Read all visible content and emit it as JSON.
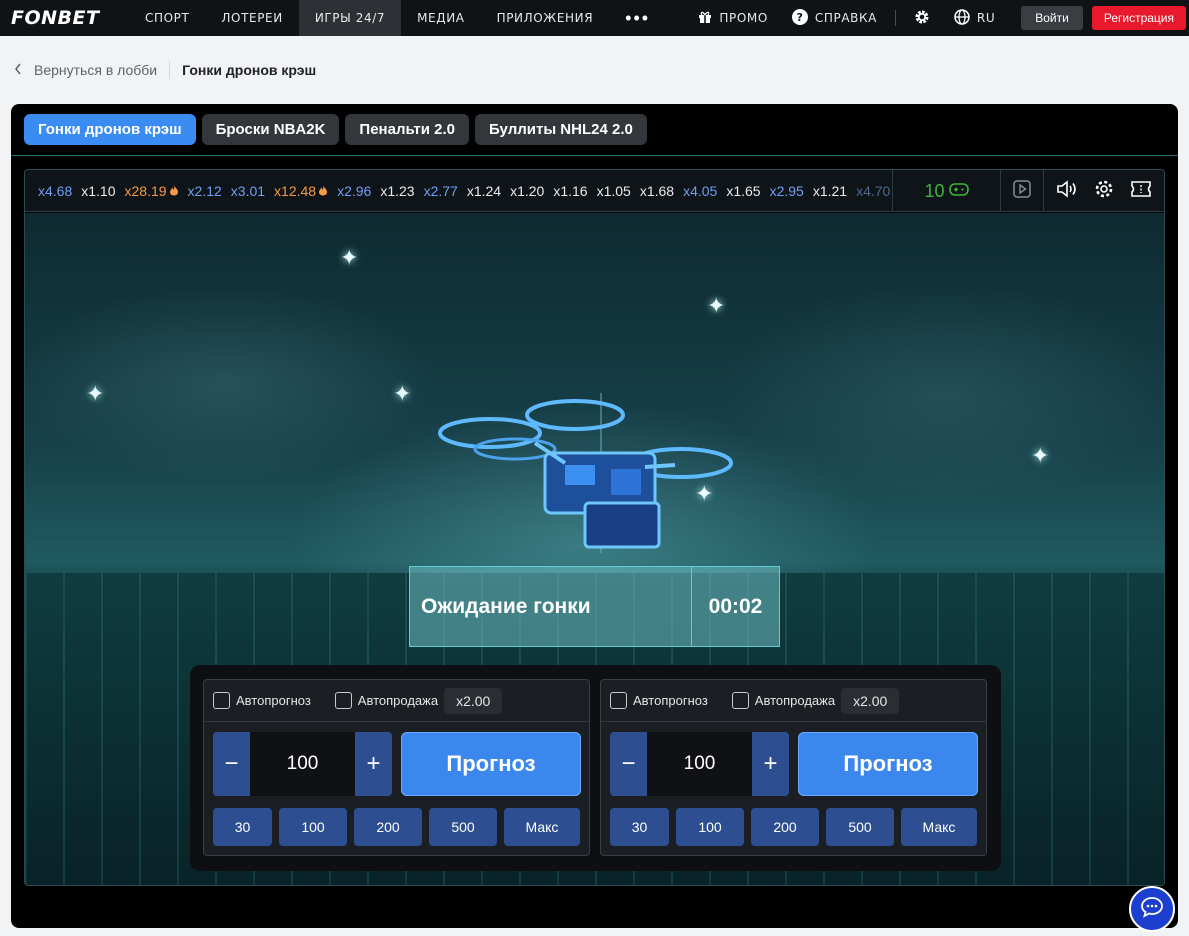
{
  "nav": {
    "logo": "FONBET",
    "items": [
      "СПОРТ",
      "ЛОТЕРЕИ",
      "ИГРЫ 24/7",
      "МЕДИА",
      "ПРИЛОЖЕНИЯ"
    ],
    "active_index": 2,
    "more": "•••",
    "promo": "ПРОМО",
    "help": "СПРАВКА",
    "lang": "RU",
    "login": "Войти",
    "register": "Регистрация"
  },
  "breadcrumb": {
    "back": "Вернуться в лобби",
    "current": "Гонки дронов крэш"
  },
  "game_tabs": [
    "Гонки дронов крэш",
    "Броски NBA2K",
    "Пенальти 2.0",
    "Буллиты NHL24 2.0"
  ],
  "multipliers": [
    {
      "v": "x4.68",
      "c": "blue"
    },
    {
      "v": "x1.10",
      "c": "white"
    },
    {
      "v": "x28.19",
      "c": "orange",
      "fire": true
    },
    {
      "v": "x2.12",
      "c": "blue"
    },
    {
      "v": "x3.01",
      "c": "blue"
    },
    {
      "v": "x12.48",
      "c": "orange",
      "fire": true
    },
    {
      "v": "x2.96",
      "c": "blue"
    },
    {
      "v": "x1.23",
      "c": "white"
    },
    {
      "v": "x2.77",
      "c": "blue"
    },
    {
      "v": "x1.24",
      "c": "white"
    },
    {
      "v": "x1.20",
      "c": "white"
    },
    {
      "v": "x1.16",
      "c": "white"
    },
    {
      "v": "x1.05",
      "c": "white"
    },
    {
      "v": "x1.68",
      "c": "white"
    },
    {
      "v": "x4.05",
      "c": "blue"
    },
    {
      "v": "x1.65",
      "c": "white"
    },
    {
      "v": "x2.95",
      "c": "blue"
    },
    {
      "v": "x1.21",
      "c": "white"
    },
    {
      "v": "x4.70",
      "c": "fade"
    }
  ],
  "players_count": "10",
  "status": {
    "text": "Ожидание гонки",
    "timer": "00:02"
  },
  "bets": [
    {
      "auto_predict": "Автопрогноз",
      "auto_sell": "Автопродажа",
      "x_value": "x2.00",
      "amount": "100",
      "minus": "−",
      "plus": "+",
      "predict": "Прогноз",
      "quick": [
        "30",
        "100",
        "200",
        "500",
        "Макс"
      ]
    },
    {
      "auto_predict": "Автопрогноз",
      "auto_sell": "Автопродажа",
      "x_value": "x2.00",
      "amount": "100",
      "minus": "−",
      "plus": "+",
      "predict": "Прогноз",
      "quick": [
        "30",
        "100",
        "200",
        "500",
        "Макс"
      ]
    }
  ],
  "colors": {
    "accent": "#3b8cf2",
    "register": "#e8192c",
    "stepper": "#2d4f92"
  }
}
